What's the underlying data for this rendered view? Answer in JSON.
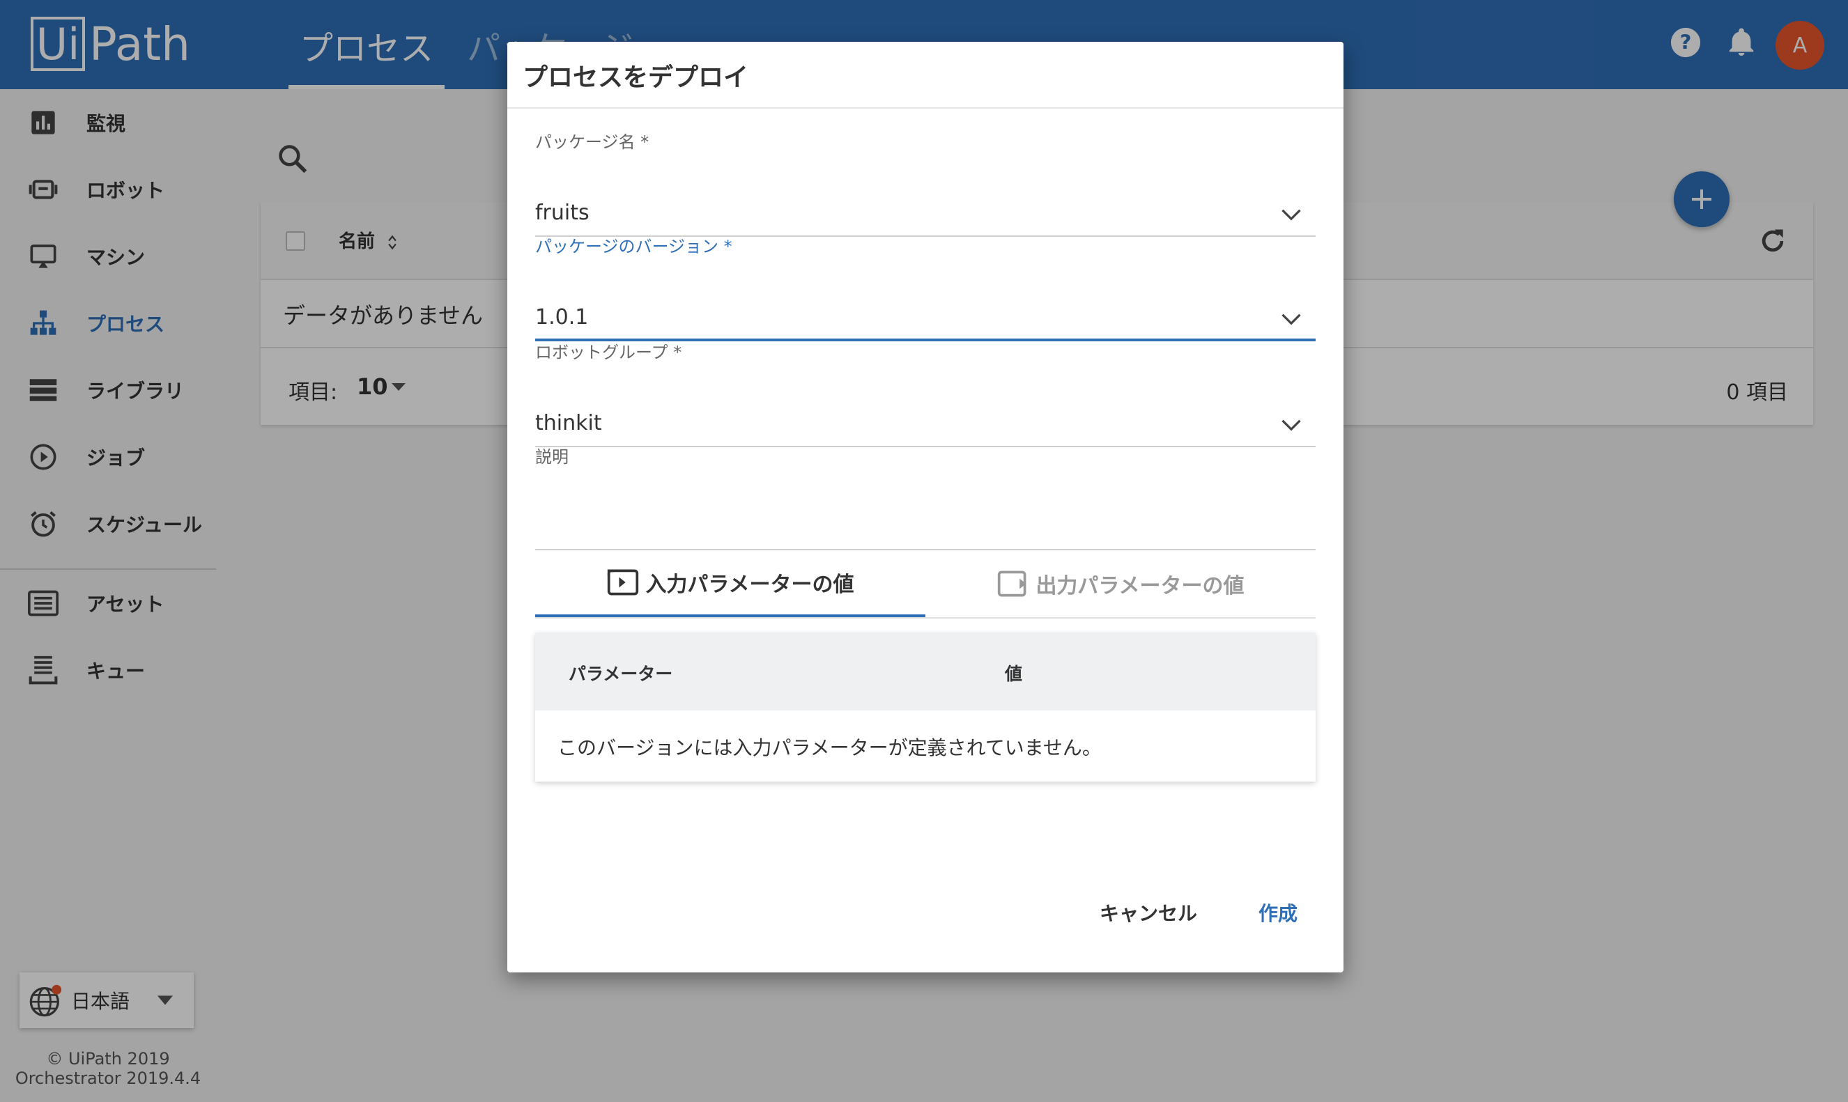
{
  "header": {
    "logo_ui": "Ui",
    "logo_path": "Path",
    "tabs": [
      {
        "label": "プロセス",
        "active": true
      },
      {
        "label": "パッケージ",
        "active": false
      }
    ],
    "help_icon": "help-icon",
    "bell_icon": "bell-icon",
    "avatar_initial": "A",
    "avatar_color": "#e8542c"
  },
  "sidebar": {
    "items": [
      {
        "label": "監視",
        "icon": "chart-icon"
      },
      {
        "label": "ロボット",
        "icon": "robot-icon"
      },
      {
        "label": "マシン",
        "icon": "machine-icon"
      },
      {
        "label": "プロセス",
        "icon": "process-icon",
        "active": true
      },
      {
        "label": "ライブラリ",
        "icon": "library-icon"
      },
      {
        "label": "ジョブ",
        "icon": "job-icon"
      },
      {
        "label": "スケジュール",
        "icon": "alarm-icon"
      },
      {
        "label": "アセット",
        "icon": "asset-icon"
      },
      {
        "label": "キュー",
        "icon": "queue-icon"
      }
    ],
    "language": "日本語",
    "copyright": "© UiPath 2019",
    "version": "Orchestrator 2019.4.4"
  },
  "main": {
    "table": {
      "col_name": "名前",
      "empty": "データがありません",
      "items_label": "項目:",
      "items_per_page": "10",
      "total": "0 項目"
    }
  },
  "dialog": {
    "title": "プロセスをデプロイ",
    "fields": {
      "package_name": {
        "label": "パッケージ名 *",
        "value": "fruits"
      },
      "package_version": {
        "label": "パッケージのバージョン *",
        "value": "1.0.1"
      },
      "robot_group": {
        "label": "ロボットグループ *",
        "value": "thinkit"
      },
      "description": {
        "label": "説明",
        "value": ""
      }
    },
    "tabs": {
      "input": "入力パラメーターの値",
      "output": "出力パラメーターの値"
    },
    "param_table": {
      "col_param": "パラメーター",
      "col_value": "値",
      "empty": "このバージョンには入力パラメーターが定義されていません。"
    },
    "cancel": "キャンセル",
    "create": "作成"
  },
  "colors": {
    "brand": "#2f6fb7",
    "accent": "#e8542c"
  }
}
